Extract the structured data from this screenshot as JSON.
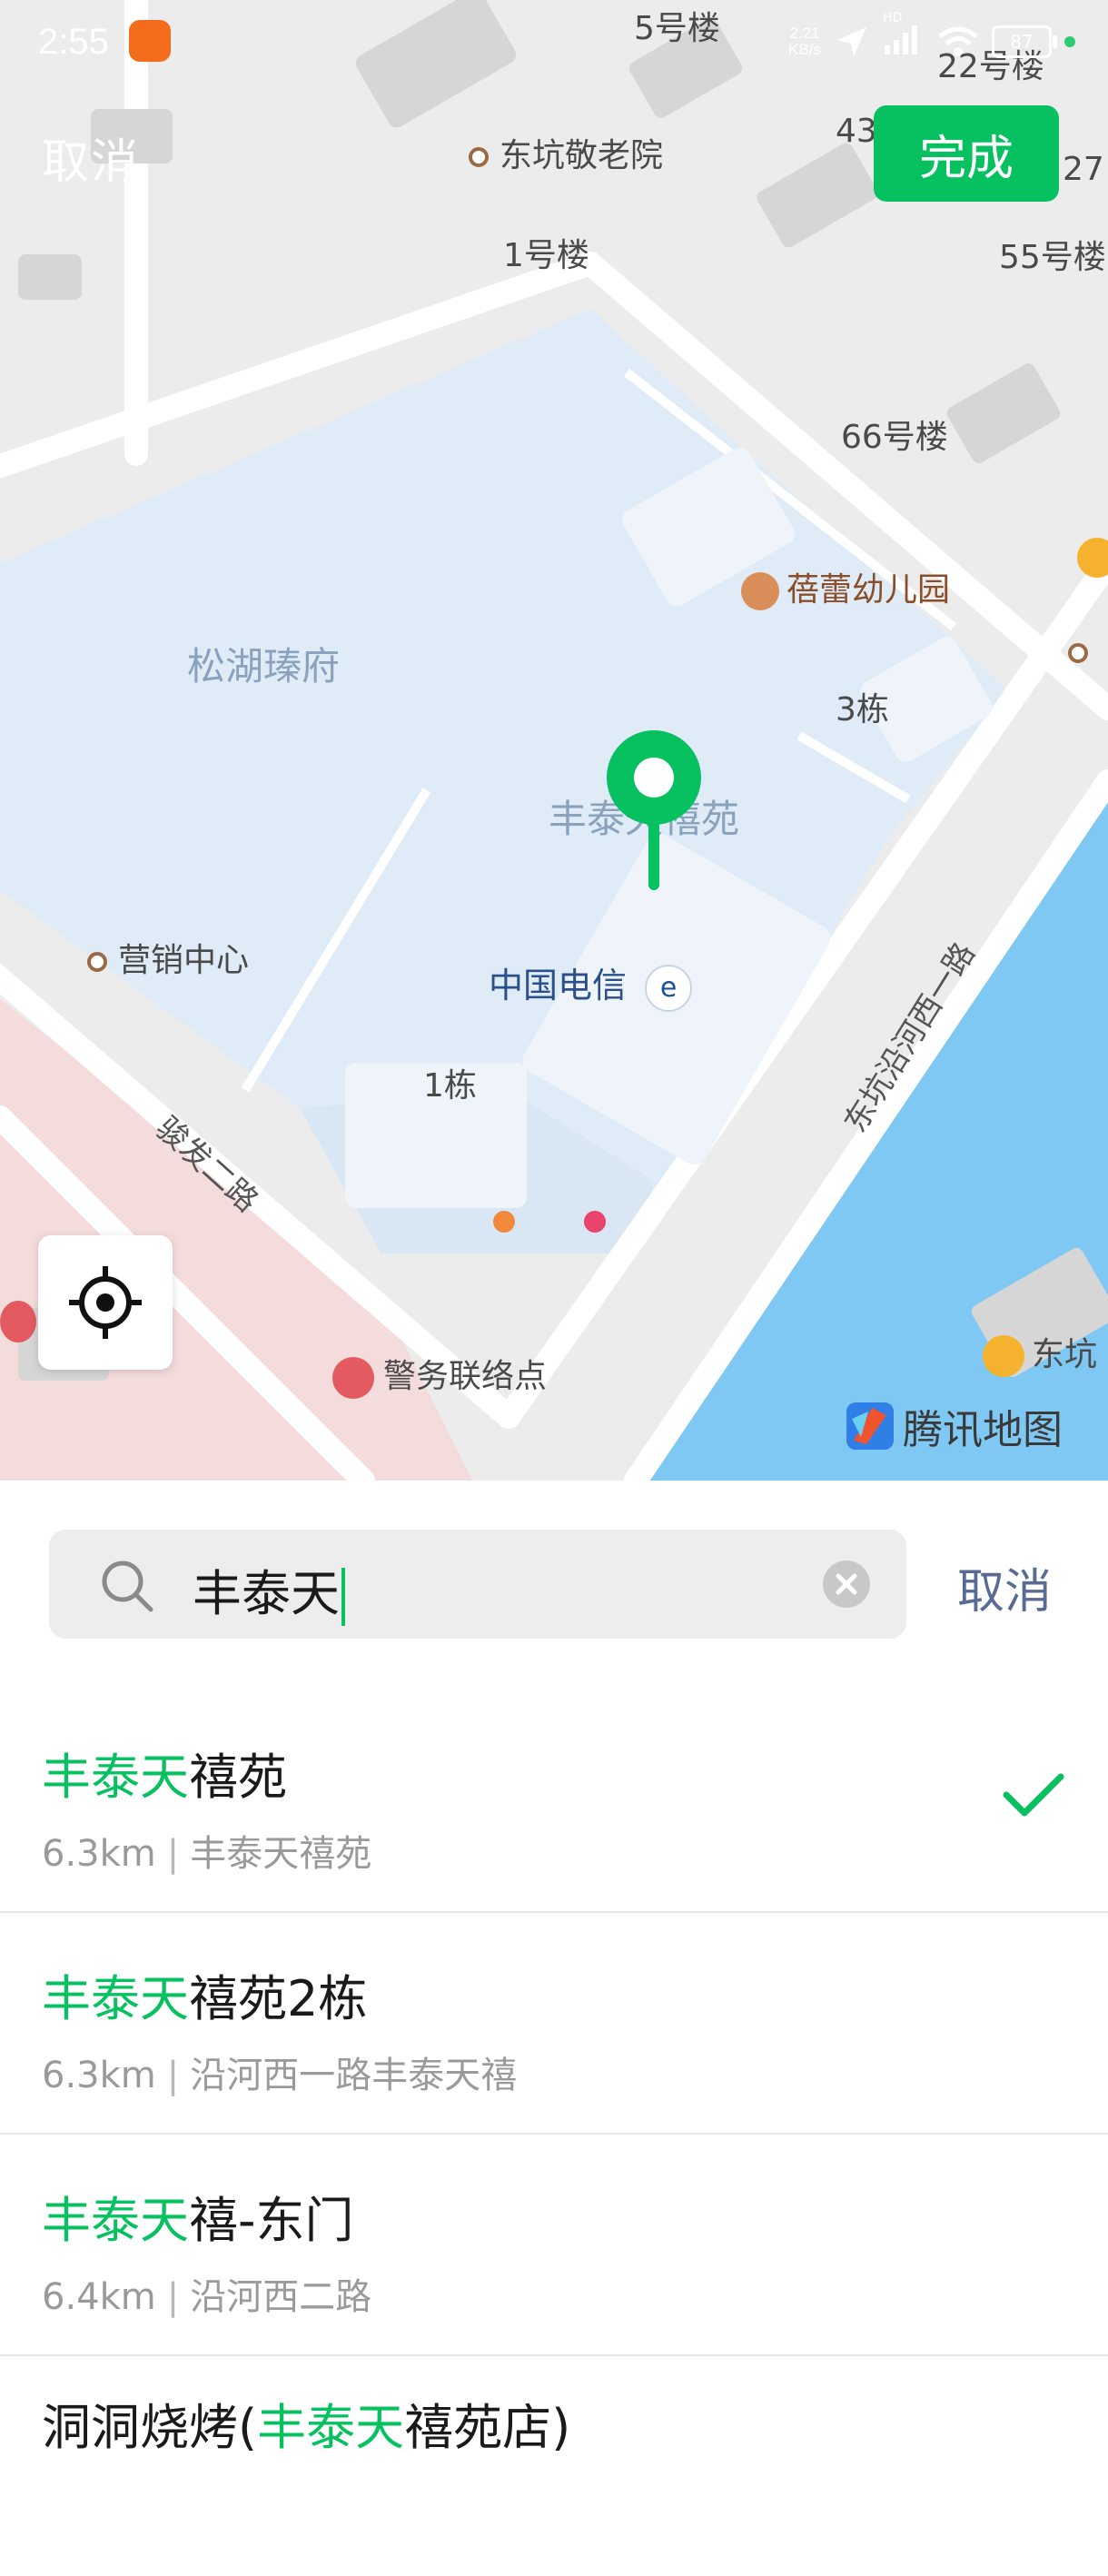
{
  "status_bar": {
    "time": "2:55",
    "net_speed_value": "2.21",
    "net_speed_unit": "KB/s",
    "network_badge": "HD",
    "battery": "87"
  },
  "map": {
    "top_cancel": "取消",
    "done_label": "完成",
    "labels": {
      "b5": "5号楼",
      "b22": "22号楼",
      "nursing_home": "东坑敬老院",
      "b43": "43",
      "b27": "27",
      "b1": "1号楼",
      "b55": "55号楼",
      "b66": "66号楼",
      "kindergarten": "蓓蕾幼儿园",
      "songhu": "松湖瑧府",
      "dong3": "3栋",
      "fengtai": "丰泰天禧苑",
      "sales": "营销中心",
      "telecom": "中国电信",
      "dong1": "1栋",
      "road1": "骏发二路",
      "road2": "东坑沿河西一路",
      "police": "警务联络点",
      "dongkeng": "东坑"
    },
    "logo_text": "腾讯地图"
  },
  "search": {
    "query": "丰泰天",
    "cancel_label": "取消"
  },
  "results": [
    {
      "highlight": "丰泰天",
      "rest": "禧苑",
      "distance": "6.3km",
      "address": "丰泰天禧苑",
      "selected": true
    },
    {
      "highlight": "丰泰天",
      "rest": "禧苑2栋",
      "distance": "6.3km",
      "address": "沿河西一路丰泰天禧",
      "selected": false
    },
    {
      "highlight": "丰泰天",
      "rest": "禧-东门",
      "distance": "6.4km",
      "address": "沿河西二路",
      "selected": false
    },
    {
      "prefix": "洞洞烧烤(",
      "highlight": "丰泰天",
      "rest": "禧苑店)",
      "selected": false
    }
  ],
  "colors": {
    "accent": "#07c160",
    "link": "#576b95",
    "water": "#7ec8f3",
    "compound": "#dfecf7"
  },
  "icons": [
    "search-icon",
    "clear-icon",
    "check-icon",
    "locate-icon",
    "map-pin-icon",
    "telecom-icon",
    "tencent-map-logo-icon"
  ]
}
